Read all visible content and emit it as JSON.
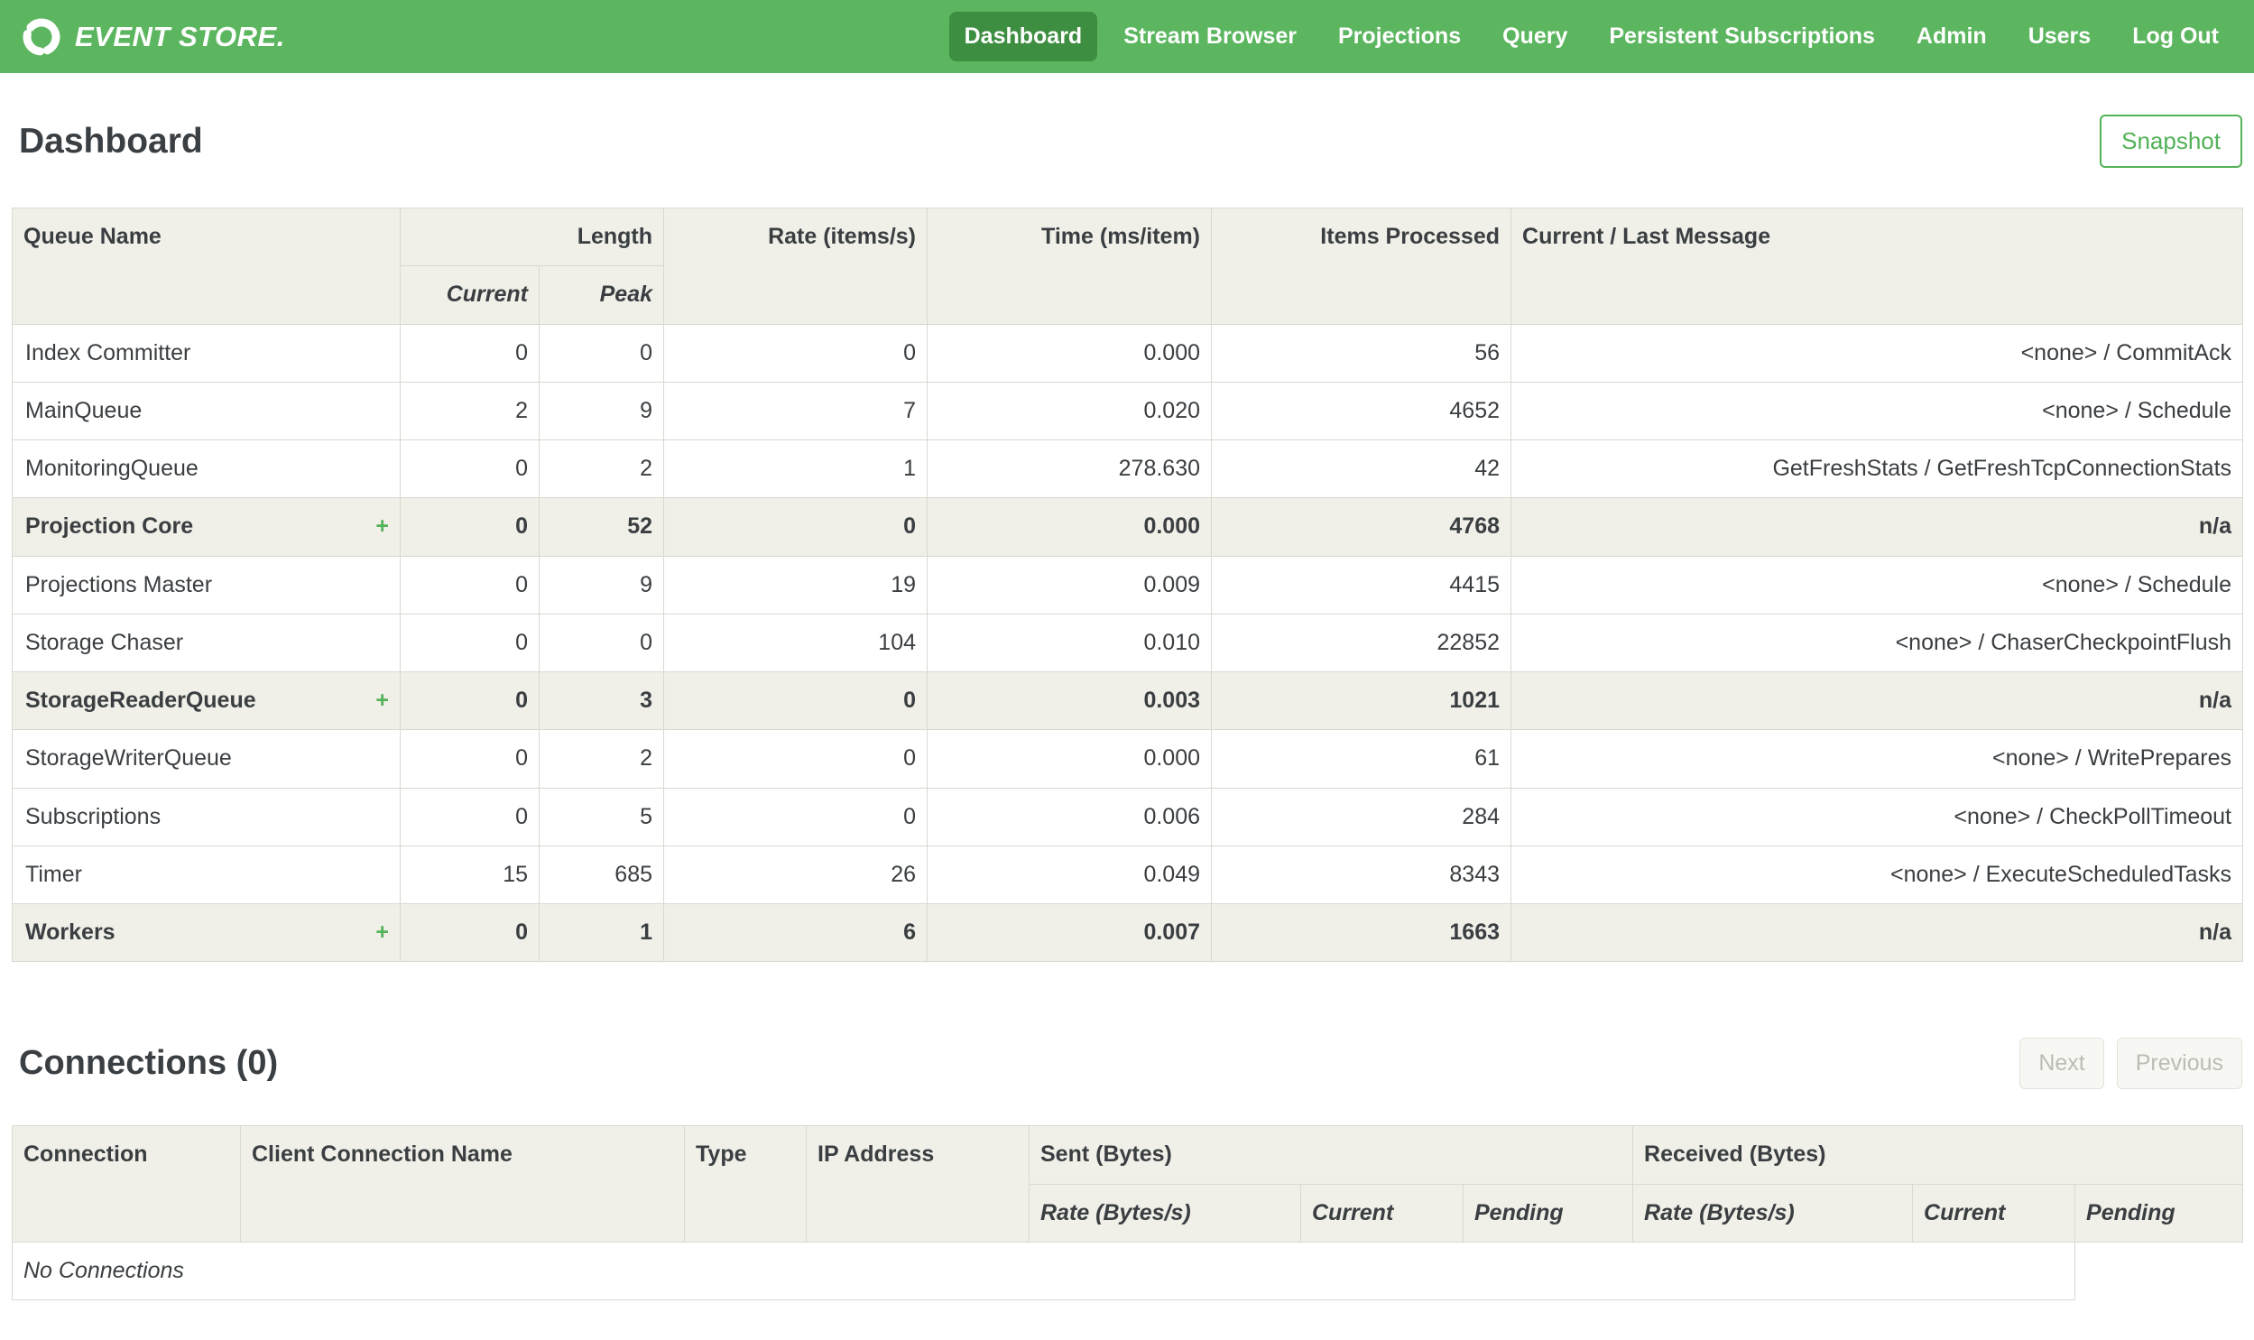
{
  "nav": {
    "brand": "EVENT STORE.",
    "items": [
      {
        "label": "Dashboard",
        "active": true
      },
      {
        "label": "Stream Browser",
        "active": false
      },
      {
        "label": "Projections",
        "active": false
      },
      {
        "label": "Query",
        "active": false
      },
      {
        "label": "Persistent Subscriptions",
        "active": false
      },
      {
        "label": "Admin",
        "active": false
      },
      {
        "label": "Users",
        "active": false
      },
      {
        "label": "Log Out",
        "active": false
      }
    ]
  },
  "page": {
    "title": "Dashboard",
    "snapshot_button": "Snapshot"
  },
  "colors": {
    "navbar_green": "#5CB660",
    "active_nav_green": "#3E8E41",
    "accent_green": "#53B257",
    "table_header_bg": "#F0F0E9",
    "border": "#D9D9D1"
  },
  "queues": {
    "expand_symbol": "+",
    "headers": {
      "queue_name": "Queue Name",
      "length": "Length",
      "current": "Current",
      "peak": "Peak",
      "rate": "Rate (items/s)",
      "time": "Time (ms/item)",
      "items_processed": "Items Processed",
      "message": "Current / Last Message"
    },
    "rows": [
      {
        "name": "Index Committer",
        "group": false,
        "current": "0",
        "peak": "0",
        "rate": "0",
        "time": "0.000",
        "items": "56",
        "message": "<none> / CommitAck"
      },
      {
        "name": "MainQueue",
        "group": false,
        "current": "2",
        "peak": "9",
        "rate": "7",
        "time": "0.020",
        "items": "4652",
        "message": "<none> / Schedule"
      },
      {
        "name": "MonitoringQueue",
        "group": false,
        "current": "0",
        "peak": "2",
        "rate": "1",
        "time": "278.630",
        "items": "42",
        "message": "GetFreshStats / GetFreshTcpConnectionStats"
      },
      {
        "name": "Projection Core",
        "group": true,
        "current": "0",
        "peak": "52",
        "rate": "0",
        "time": "0.000",
        "items": "4768",
        "message": "n/a"
      },
      {
        "name": "Projections Master",
        "group": false,
        "current": "0",
        "peak": "9",
        "rate": "19",
        "time": "0.009",
        "items": "4415",
        "message": "<none> / Schedule"
      },
      {
        "name": "Storage Chaser",
        "group": false,
        "current": "0",
        "peak": "0",
        "rate": "104",
        "time": "0.010",
        "items": "22852",
        "message": "<none> / ChaserCheckpointFlush"
      },
      {
        "name": "StorageReaderQueue",
        "group": true,
        "current": "0",
        "peak": "3",
        "rate": "0",
        "time": "0.003",
        "items": "1021",
        "message": "n/a"
      },
      {
        "name": "StorageWriterQueue",
        "group": false,
        "current": "0",
        "peak": "2",
        "rate": "0",
        "time": "0.000",
        "items": "61",
        "message": "<none> / WritePrepares"
      },
      {
        "name": "Subscriptions",
        "group": false,
        "current": "0",
        "peak": "5",
        "rate": "0",
        "time": "0.006",
        "items": "284",
        "message": "<none> / CheckPollTimeout"
      },
      {
        "name": "Timer",
        "group": false,
        "current": "15",
        "peak": "685",
        "rate": "26",
        "time": "0.049",
        "items": "8343",
        "message": "<none> / ExecuteScheduledTasks"
      },
      {
        "name": "Workers",
        "group": true,
        "current": "0",
        "peak": "1",
        "rate": "6",
        "time": "0.007",
        "items": "1663",
        "message": "n/a"
      }
    ]
  },
  "connections": {
    "title": "Connections (0)",
    "next_button": "Next",
    "previous_button": "Previous",
    "headers": {
      "connection": "Connection",
      "client_connection_name": "Client Connection Name",
      "type": "Type",
      "ip_address": "IP Address",
      "sent": "Sent (Bytes)",
      "received": "Received (Bytes)",
      "rate": "Rate (Bytes/s)",
      "current": "Current",
      "pending": "Pending"
    },
    "empty_message": "No Connections"
  }
}
